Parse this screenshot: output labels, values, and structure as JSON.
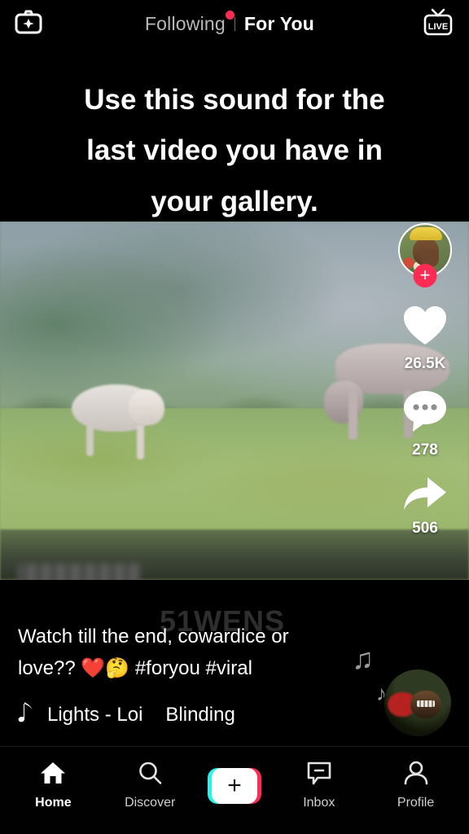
{
  "top_nav": {
    "camera_icon": "camera-effects-icon",
    "live_icon": "live-tv-icon",
    "tabs": [
      {
        "label": "Following",
        "active": false,
        "has_badge": true
      },
      {
        "label": "For You",
        "active": true,
        "has_badge": false
      }
    ]
  },
  "burned_in_text": {
    "lines": [
      "Use this sound for the",
      "last video you have in",
      "your gallery."
    ]
  },
  "action_rail": {
    "avatar_name": "creator-avatar",
    "follow_label": "+",
    "like": {
      "icon": "heart-icon",
      "count": "26.5K"
    },
    "comment": {
      "icon": "comment-icon",
      "count": "278"
    },
    "share": {
      "icon": "share-arrow-icon",
      "count": "506"
    }
  },
  "video_info": {
    "caption": "Watch till the end, cowardice or love?? ❤️🤔 #foryou #viral",
    "music_icon": "music-note-icon",
    "music_title": "Lights - Loi",
    "music_extra": "Blinding",
    "source_watermark": "51WENS"
  },
  "bottom_nav": {
    "items": [
      {
        "label": "Home",
        "icon": "home-icon",
        "active": true
      },
      {
        "label": "Discover",
        "icon": "search-icon",
        "active": false
      },
      {
        "label": "Inbox",
        "icon": "inbox-icon",
        "active": false
      },
      {
        "label": "Profile",
        "icon": "person-icon",
        "active": false
      }
    ],
    "create_label": "+"
  },
  "colors": {
    "accent_red": "#fe2c55",
    "accent_cyan": "#25f4ee",
    "background": "#000000",
    "text_primary": "#ffffff",
    "text_muted": "#b9b9b9"
  }
}
